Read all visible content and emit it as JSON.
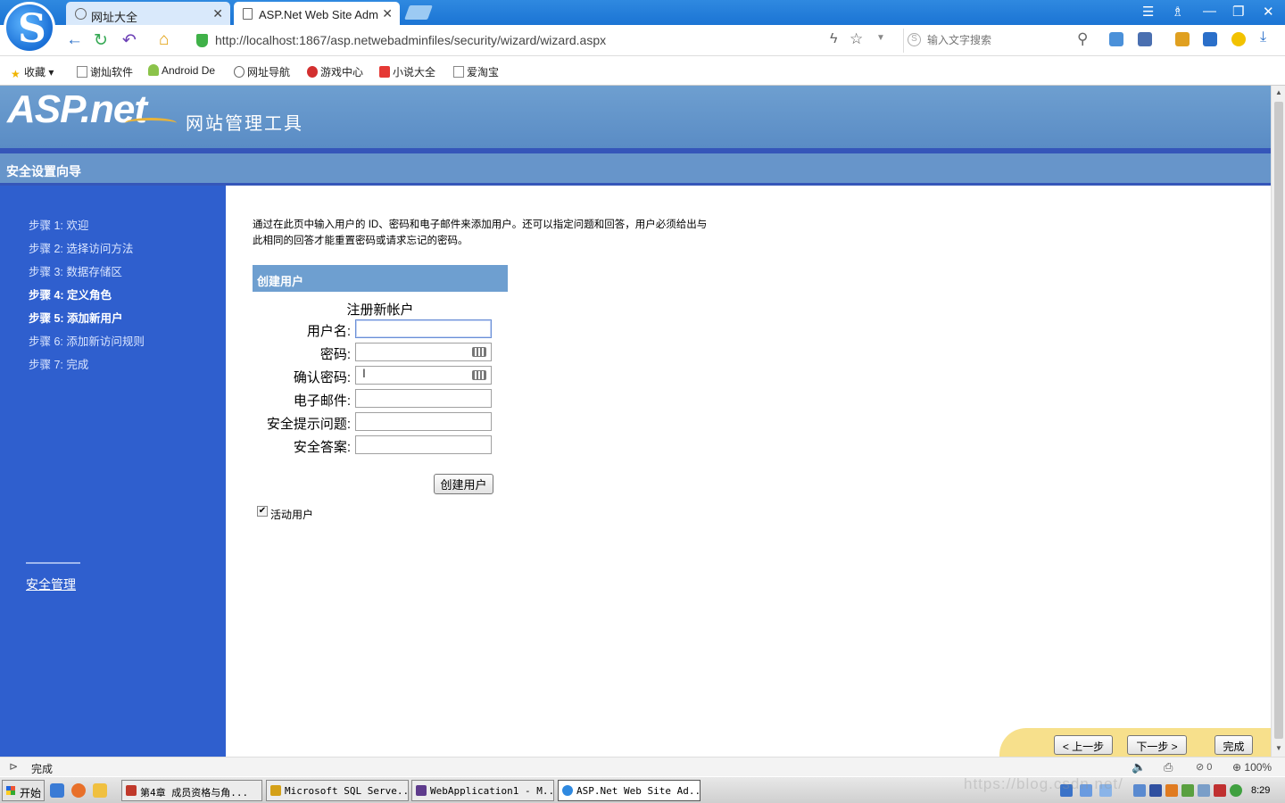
{
  "browser": {
    "tabs": [
      {
        "title": "网址大全"
      },
      {
        "title": "ASP.Net Web Site Adm"
      }
    ],
    "url": "http://localhost:1867/asp.netwebadminfiles/security/wizard/wizard.aspx",
    "search_placeholder": "输入文字搜索",
    "bookmarks": [
      {
        "label": "收藏"
      },
      {
        "label": "谢灿软件"
      },
      {
        "label": "Android De"
      },
      {
        "label": "网址导航"
      },
      {
        "label": "游戏中心"
      },
      {
        "label": "小说大全"
      },
      {
        "label": "爱淘宝"
      }
    ],
    "status_text": "完成",
    "ad_count": "0",
    "zoom": "100%"
  },
  "page": {
    "logo": "ASP.net",
    "tool_title": "网站管理工具",
    "wizard_title": "安全设置向导",
    "steps": [
      {
        "label": "步骤 1: 欢迎"
      },
      {
        "label": "步骤 2: 选择访问方法"
      },
      {
        "label": "步骤 3: 数据存储区"
      },
      {
        "label": "步骤 4: 定义角色"
      },
      {
        "label": "步骤 5: 添加新用户"
      },
      {
        "label": "步骤 6: 添加新访问规则"
      },
      {
        "label": "步骤 7: 完成"
      }
    ],
    "security_link": "安全管理",
    "intro_text": "通过在此页中输入用户的 ID、密码和电子邮件来添加用户。还可以指定问题和回答，用户必须给出与此相同的回答才能重置密码或请求忘记的密码。",
    "panel_title": "创建用户",
    "form_title": "注册新帐户",
    "fields": {
      "username": {
        "label": "用户名:",
        "value": ""
      },
      "password": {
        "label": "密码:",
        "value": ""
      },
      "confirm_password": {
        "label": "确认密码:",
        "value": ""
      },
      "email": {
        "label": "电子邮件:",
        "value": ""
      },
      "question": {
        "label": "安全提示问题:",
        "value": ""
      },
      "answer": {
        "label": "安全答案:",
        "value": ""
      }
    },
    "create_button": "创建用户",
    "active_user_label": "活动用户",
    "active_user_checked": true,
    "nav": {
      "prev": "< 上一步",
      "next": "下一步 >",
      "finish": "完成"
    }
  },
  "taskbar": {
    "start": "开始",
    "tasks": [
      {
        "label": "第4章 成员资格与角..."
      },
      {
        "label": "Microsoft SQL Serve..."
      },
      {
        "label": "WebApplication1 - M..."
      },
      {
        "label": "ASP.Net Web Site Ad..."
      }
    ],
    "clock": "8:29",
    "watermark": "https://blog.csdn.net/"
  }
}
